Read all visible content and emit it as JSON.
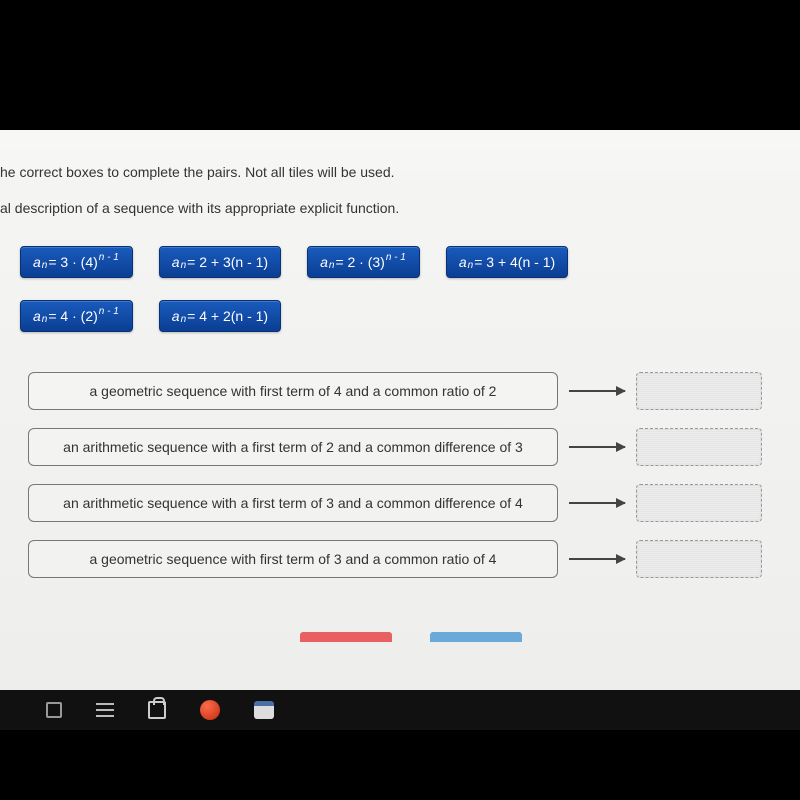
{
  "instructions": {
    "line1": "he correct boxes to complete the pairs. Not all tiles will be used.",
    "line2": "al description of a sequence with its appropriate explicit function."
  },
  "tiles": [
    {
      "id": "tile-3x4n1",
      "a": "a",
      "sub": "n",
      "expr": " = 3 · (4)",
      "sup": "n - 1",
      "tail": ""
    },
    {
      "id": "tile-2p3n1",
      "a": "a",
      "sub": "n",
      "expr": " = 2 + 3(n - 1)",
      "sup": "",
      "tail": ""
    },
    {
      "id": "tile-2x3n1",
      "a": "a",
      "sub": "n",
      "expr": " = 2 · (3)",
      "sup": "n - 1",
      "tail": ""
    },
    {
      "id": "tile-3p4n1",
      "a": "a",
      "sub": "n",
      "expr": " = 3 + 4(n - 1)",
      "sup": "",
      "tail": ""
    },
    {
      "id": "tile-4x2n1",
      "a": "a",
      "sub": "n",
      "expr": " = 4 · (2)",
      "sup": "n - 1",
      "tail": ""
    },
    {
      "id": "tile-4p2n1",
      "a": "a",
      "sub": "n",
      "expr": " = 4 + 2(n - 1)",
      "sup": "",
      "tail": ""
    }
  ],
  "descriptions": [
    "a geometric sequence with first term of 4 and a common ratio of 2",
    "an arithmetic sequence with a first term of 2 and a common difference of 3",
    "an arithmetic sequence with a first term of 3 and a common difference of 4",
    "a geometric sequence with first term of 3 and a common ratio of 4"
  ],
  "buttons": {
    "reset_color": "#e86062",
    "submit_color": "#6aa9d8"
  }
}
